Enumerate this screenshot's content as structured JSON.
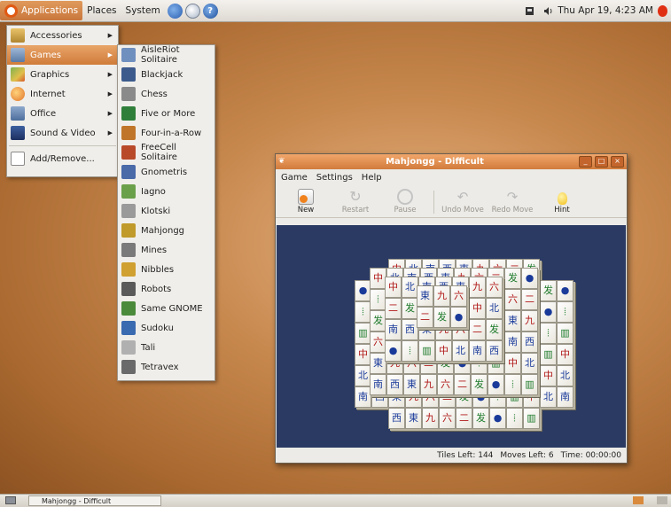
{
  "top_panel": {
    "menus": [
      "Applications",
      "Places",
      "System"
    ],
    "clock": "Thu Apr 19,  4:23 AM"
  },
  "applications_menu": {
    "items": [
      {
        "label": "Accessories",
        "icon": "accessories-icon",
        "submenu": true
      },
      {
        "label": "Games",
        "icon": "games-icon",
        "submenu": true,
        "highlighted": true
      },
      {
        "label": "Graphics",
        "icon": "graphics-icon",
        "submenu": true
      },
      {
        "label": "Internet",
        "icon": "internet-icon",
        "submenu": true
      },
      {
        "label": "Office",
        "icon": "office-icon",
        "submenu": true
      },
      {
        "label": "Sound & Video",
        "icon": "sound-video-icon",
        "submenu": true
      }
    ],
    "add_remove": "Add/Remove..."
  },
  "games_menu": {
    "items": [
      "AisleRiot Solitaire",
      "Blackjack",
      "Chess",
      "Five or More",
      "Four-in-a-Row",
      "FreeCell Solitaire",
      "Gnometris",
      "Iagno",
      "Klotski",
      "Mahjongg",
      "Mines",
      "Nibbles",
      "Robots",
      "Same GNOME",
      "Sudoku",
      "Tali",
      "Tetravex"
    ]
  },
  "window": {
    "title": "Mahjongg - Difficult",
    "menubar": [
      "Game",
      "Settings",
      "Help"
    ],
    "toolbar": {
      "new": "New",
      "restart": "Restart",
      "pause": "Pause",
      "undo": "Undo Move",
      "redo": "Redo Move",
      "hint": "Hint"
    },
    "status": {
      "tiles_left": "Tiles Left: 144",
      "moves_left": "Moves Left: 6",
      "time": "Time: 00:00:00"
    }
  },
  "taskbar": {
    "task_label": "Mahjongg - Difficult"
  },
  "colors": {
    "accent": "#d07c3a",
    "board": "#2a3a63"
  }
}
